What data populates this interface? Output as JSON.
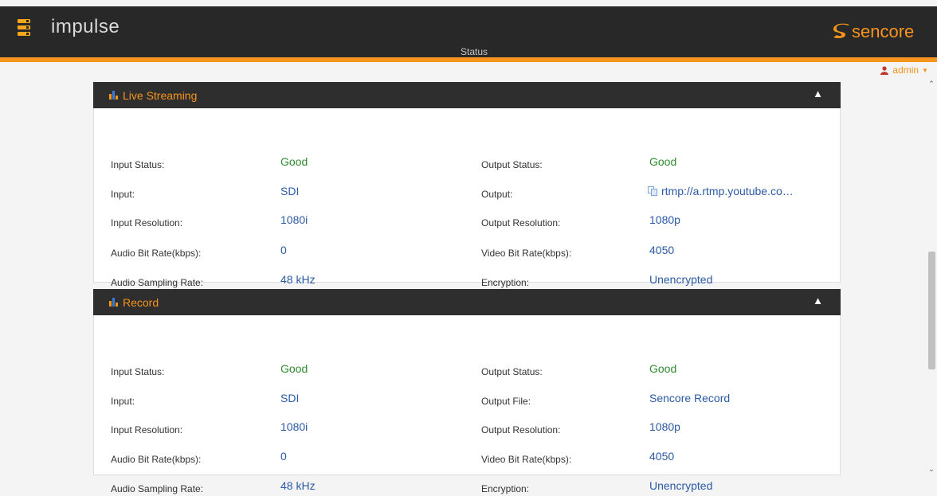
{
  "app": {
    "name": "impulse",
    "page_title": "Status",
    "logo_text": "sencore"
  },
  "user": {
    "name": "admin"
  },
  "colors": {
    "accent": "#f7941d",
    "good": "#2e8b2e",
    "value": "#2b5aa5",
    "header_bg": "#282828"
  },
  "icons": {
    "menu": "menu-icon",
    "panel": "bar-chart-icon",
    "collapse": "chevron-up-icon",
    "copy": "copy-icon",
    "user": "user-icon"
  },
  "live_streaming": {
    "title": "Live Streaming",
    "input_status_label": "Input Status:",
    "input_status": "Good",
    "output_status_label": "Output Status:",
    "output_status": "Good",
    "input_label": "Input:",
    "input": "SDI",
    "output_label": "Output:",
    "output": "rtmp://a.rtmp.youtube.co…",
    "input_res_label": "Input Resolution:",
    "input_res": "1080i",
    "output_res_label": "Output Resolution:",
    "output_res": "1080p",
    "audio_bitrate_label": "Audio Bit Rate(kbps):",
    "audio_bitrate": "0",
    "video_bitrate_label": "Video Bit Rate(kbps):",
    "video_bitrate": "4050",
    "audio_sampling_label": "Audio Sampling Rate:",
    "audio_sampling": "48 kHz",
    "encryption_label": "Encryption:",
    "encryption": "Unencrypted"
  },
  "record": {
    "title": "Record",
    "input_status_label": "Input Status:",
    "input_status": "Good",
    "output_status_label": "Output Status:",
    "output_status": "Good",
    "input_label": "Input:",
    "input": "SDI",
    "output_file_label": "Output File:",
    "output_file": "Sencore Record",
    "input_res_label": "Input Resolution:",
    "input_res": "1080i",
    "output_res_label": "Output Resolution:",
    "output_res": "1080p",
    "audio_bitrate_label": "Audio Bit Rate(kbps):",
    "audio_bitrate": "0",
    "video_bitrate_label": "Video Bit Rate(kbps):",
    "video_bitrate": "4050",
    "audio_sampling_label": "Audio Sampling Rate:",
    "audio_sampling": "48 kHz",
    "encryption_label": "Encryption:",
    "encryption": "Unencrypted"
  }
}
